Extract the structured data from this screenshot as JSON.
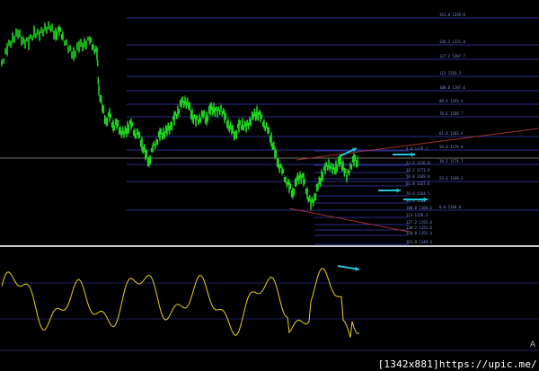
{
  "fib_labels_main": [
    {
      "text": "161.8 1239.6",
      "y": 1239.6
    },
    {
      "text": "136.2 1231.8",
      "y": 1231.8
    },
    {
      "text": "127.2 1207.7",
      "y": 1207.7
    },
    {
      "text": "113 1203.3",
      "y": 1203.3
    },
    {
      "text": "100.0 1197.6",
      "y": 1197.6
    },
    {
      "text": "88.6 1193.4",
      "y": 1193.4
    },
    {
      "text": "78.6 1189.7",
      "y": 1189.7
    },
    {
      "text": "61.8 1183.4",
      "y": 1183.4
    },
    {
      "text": "50.0 1179.0",
      "y": 1179.0
    },
    {
      "text": "38.2 1174.7",
      "y": 1174.7
    },
    {
      "text": "23.6 1169.3",
      "y": 1169.3
    },
    {
      "text": "0.0 1160.6",
      "y": 1160.6
    }
  ],
  "fib_labels_lower": [
    {
      "text": "0.0 1179.2",
      "y": 1179.2
    },
    {
      "text": "23.6 1176.8",
      "y": 1176.8
    },
    {
      "text": "38.2 1171.9",
      "y": 1171.9
    },
    {
      "text": "50.0 1169.8",
      "y": 1169.8
    },
    {
      "text": "61.8 1167.6",
      "y": 1167.6
    },
    {
      "text": "78.6 1164.5",
      "y": 1164.5
    },
    {
      "text": "88.6 1162.7",
      "y": 1162.7
    },
    {
      "text": "100.0 1160.6",
      "y": 1160.6
    },
    {
      "text": "113 1158.3",
      "y": 1158.3
    },
    {
      "text": "127.2 1155.6",
      "y": 1155.6
    },
    {
      "text": "138.2 1153.6",
      "y": 1153.6
    },
    {
      "text": "150.0 1151.4",
      "y": 1151.4
    },
    {
      "text": "161.8 1149.3",
      "y": 1149.3
    }
  ],
  "colors": {
    "background": "#000000",
    "candles": "#1fd61f",
    "oscillator": "#e6d21a",
    "fib_lines": "#2a2f8c",
    "trendline": "#a0302c",
    "arrows": "#26c6da",
    "separator": "#cfcfcf",
    "hline": "#6e6e6e"
  },
  "panel_letter": "A",
  "watermark": "[1342x881]https://upic.me/"
}
